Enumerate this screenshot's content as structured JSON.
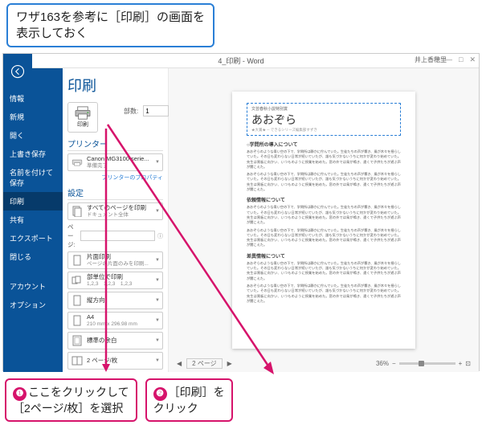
{
  "topcallout": {
    "l1": "ワザ163を参考に［印刷］の画面を",
    "l2": "表示しておく"
  },
  "title": "4_印刷 - Word",
  "user": "井上香穂里",
  "sidebar": [
    {
      "label": "情報"
    },
    {
      "label": "新規"
    },
    {
      "label": "開く"
    },
    {
      "label": "上書き保存"
    },
    {
      "label": "名前を付けて保存"
    },
    {
      "label": "印刷",
      "sel": true
    },
    {
      "label": "共有"
    },
    {
      "label": "エクスポート"
    },
    {
      "label": "閉じる"
    },
    {
      "label": "アカウント"
    },
    {
      "label": "オプション"
    }
  ],
  "panel": {
    "heading": "印刷",
    "printLabel": "印刷",
    "copiesLabel": "部数:",
    "copiesValue": "1",
    "printerSection": "プリンター",
    "printerName": "Canon MG3100 serie...",
    "printerStatus": "準備完了",
    "printerPropLink": "プリンターのプロパティ",
    "settingsSection": "設定",
    "s1a": "すべてのページを印刷",
    "s1b": "ドキュメント全体",
    "pageLabel": "ページ:",
    "s2a": "片面印刷",
    "s2b": "ページの片面のみを印刷...",
    "s3a": "部単位で印刷",
    "s3b": "1,2,3　1,2,3　1,2,3",
    "s4": "縦方向",
    "s5a": "A4",
    "s5b": "210 mm x 296.98 mm",
    "s6": "標準の余白",
    "s7": "2 ページ/枚"
  },
  "preview": {
    "boxSub": "文芸春秋小説特別賞",
    "boxMain": "あおぞら",
    "boxTag": "★大賞★ ─ できるシリーズ編集部すずき",
    "h1": "○学問所の導入について",
    "h2": "依頼情報について",
    "h3": "差異情報について",
    "para": "あおぞらのような青い空の下で、学問所は静かに佇んでいた。生徒たちの声が響き、風が木々を揺らしていた。その日も変わらない日常が続いていたが、誰も気づかないうちに何かが変わり始めていた。先生は黒板に向かい、いつものように授業を始めた。窓の外では鳥が鳴き、遠くで子供たちが遊ぶ声が聞こえた。",
    "footerPage": "2 ページ"
  },
  "zoom": "36%",
  "callout1": {
    "num": "❶",
    "l1": "ここをクリックして",
    "l2": "［2ページ/枚］を選択"
  },
  "callout2": {
    "num": "❷",
    "l1": "［印刷］を",
    "l2": "クリック"
  }
}
